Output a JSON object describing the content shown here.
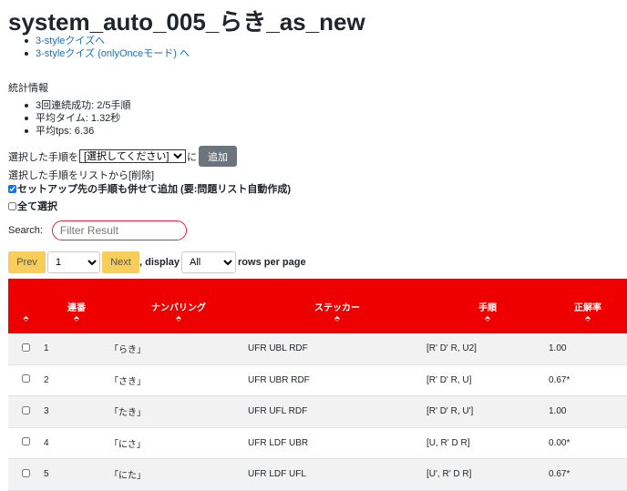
{
  "page": {
    "title": "system_auto_005_らき_as_new",
    "links": [
      {
        "label": "3-styleクイズへ"
      },
      {
        "label": "3-styleクイズ (onlyOnceモード) へ"
      }
    ]
  },
  "stats": {
    "heading": "統計情報",
    "items": [
      "3回連続成功: 2/5手順",
      "平均タイム: 1.32秒",
      "平均tps: 6.36"
    ]
  },
  "controls": {
    "select_prefix": "選択した手順を",
    "select_value": "[選択してください]",
    "select_suffix": "に",
    "add_label": "追加",
    "delete_text": "選択した手順をリストから[削除]",
    "setup_checkbox_label": "セットアップ先の手順も併せて追加 (要:問題リスト自動作成)",
    "select_all_label": "全て選択"
  },
  "search": {
    "label": "Search:",
    "placeholder": "Filter Result"
  },
  "pagination": {
    "prev_label": "Prev",
    "page_value": "1",
    "next_label": "Next",
    "display_label": ", display",
    "rows_value": "All",
    "rows_suffix": "rows per page"
  },
  "table": {
    "headers": [
      "",
      "連番",
      "ナンバリング",
      "ステッカー",
      "手順",
      "正解率"
    ],
    "sort_icon": "⬘",
    "rows": [
      {
        "no": "1",
        "numbering": "「らき」",
        "sticker": "UFR UBL RDF",
        "procedure": "[R' D' R, U2]",
        "rate": "1.00"
      },
      {
        "no": "2",
        "numbering": "「さき」",
        "sticker": "UFR UBR RDF",
        "procedure": "[R' D' R, U]",
        "rate": "0.67*"
      },
      {
        "no": "3",
        "numbering": "「たき」",
        "sticker": "UFR UFL RDF",
        "procedure": "[R' D' R, U']",
        "rate": "1.00"
      },
      {
        "no": "4",
        "numbering": "「にさ」",
        "sticker": "UFR LDF UBR",
        "procedure": "[U, R' D R]",
        "rate": "0.00*"
      },
      {
        "no": "5",
        "numbering": "「にた」",
        "sticker": "UFR LDF UFL",
        "procedure": "[U', R' D R]",
        "rate": "0.67*"
      }
    ]
  },
  "colors": {
    "header_bg": "#ee0000",
    "link": "#1f6fb5",
    "pager_button": "#f8cd5a",
    "add_button": "#6c757d",
    "search_border": "#e8253b"
  }
}
